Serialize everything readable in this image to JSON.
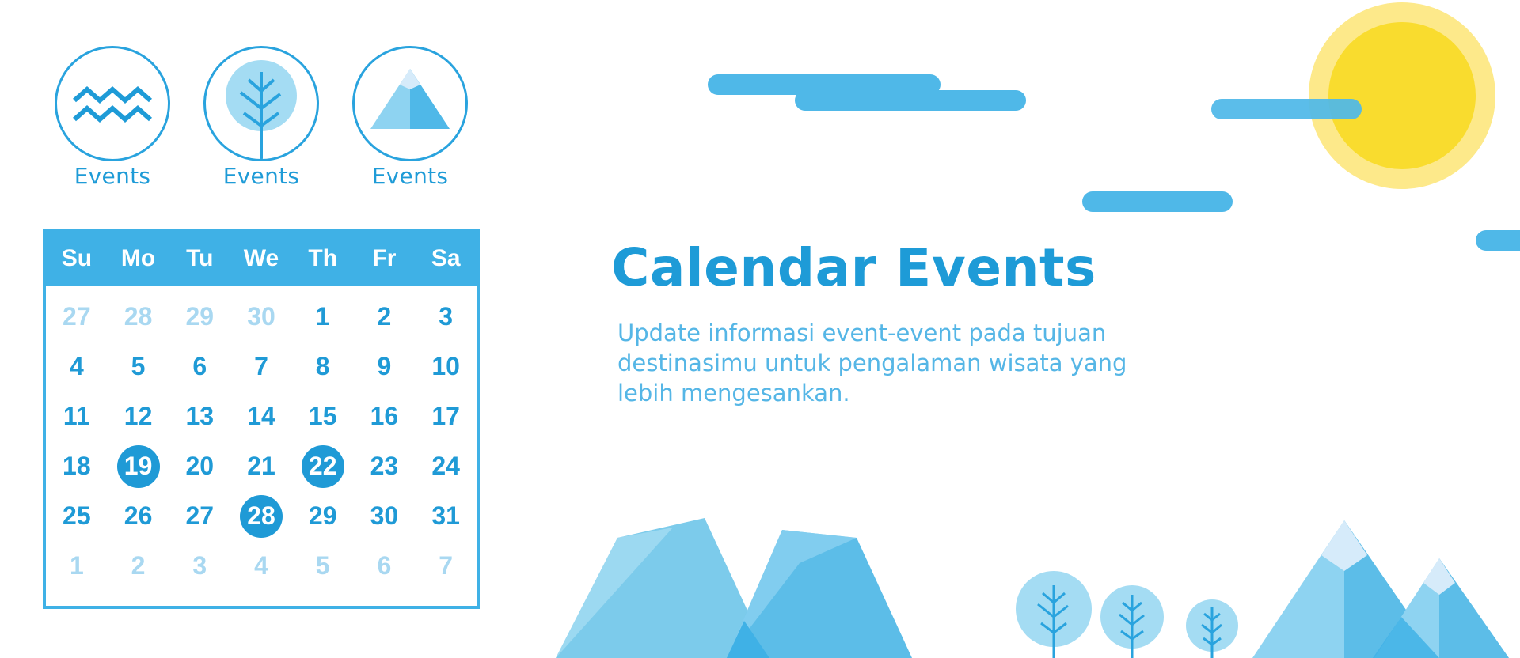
{
  "categories": [
    {
      "label": "Events",
      "icon": "water-waves-icon"
    },
    {
      "label": "Events",
      "icon": "tree-icon"
    },
    {
      "label": "Events",
      "icon": "mountain-icon"
    }
  ],
  "calendar": {
    "weekdays": [
      "Su",
      "Mo",
      "Tu",
      "We",
      "Th",
      "Fr",
      "Sa"
    ],
    "weeks": [
      [
        {
          "d": "27",
          "muted": true
        },
        {
          "d": "28",
          "muted": true
        },
        {
          "d": "29",
          "muted": true
        },
        {
          "d": "30",
          "muted": true
        },
        {
          "d": "1"
        },
        {
          "d": "2"
        },
        {
          "d": "3"
        }
      ],
      [
        {
          "d": "4"
        },
        {
          "d": "5"
        },
        {
          "d": "6"
        },
        {
          "d": "7"
        },
        {
          "d": "8"
        },
        {
          "d": "9"
        },
        {
          "d": "10"
        }
      ],
      [
        {
          "d": "11"
        },
        {
          "d": "12"
        },
        {
          "d": "13"
        },
        {
          "d": "14"
        },
        {
          "d": "15"
        },
        {
          "d": "16"
        },
        {
          "d": "17"
        }
      ],
      [
        {
          "d": "18"
        },
        {
          "d": "19",
          "event": true
        },
        {
          "d": "20"
        },
        {
          "d": "21"
        },
        {
          "d": "22",
          "event": true
        },
        {
          "d": "23"
        },
        {
          "d": "24"
        }
      ],
      [
        {
          "d": "25"
        },
        {
          "d": "26"
        },
        {
          "d": "27"
        },
        {
          "d": "28",
          "event": true
        },
        {
          "d": "29"
        },
        {
          "d": "30"
        },
        {
          "d": "31"
        }
      ],
      [
        {
          "d": "1",
          "muted": true
        },
        {
          "d": "2",
          "muted": true
        },
        {
          "d": "3",
          "muted": true
        },
        {
          "d": "4",
          "muted": true
        },
        {
          "d": "5",
          "muted": true
        },
        {
          "d": "6",
          "muted": true
        },
        {
          "d": "7",
          "muted": true
        }
      ]
    ]
  },
  "hero": {
    "title": "Calendar Events",
    "description": "Update informasi event-event pada tujuan destinasimu untuk pengalaman wisata yang lebih mengesankan."
  },
  "colors": {
    "primary": "#1e9bd7",
    "accent": "#3fb1e6",
    "muted_date": "#a9d8f1",
    "sun": "#f9dc2e",
    "sun_glow": "#fde98a",
    "cloud": "#4fb8e8"
  }
}
